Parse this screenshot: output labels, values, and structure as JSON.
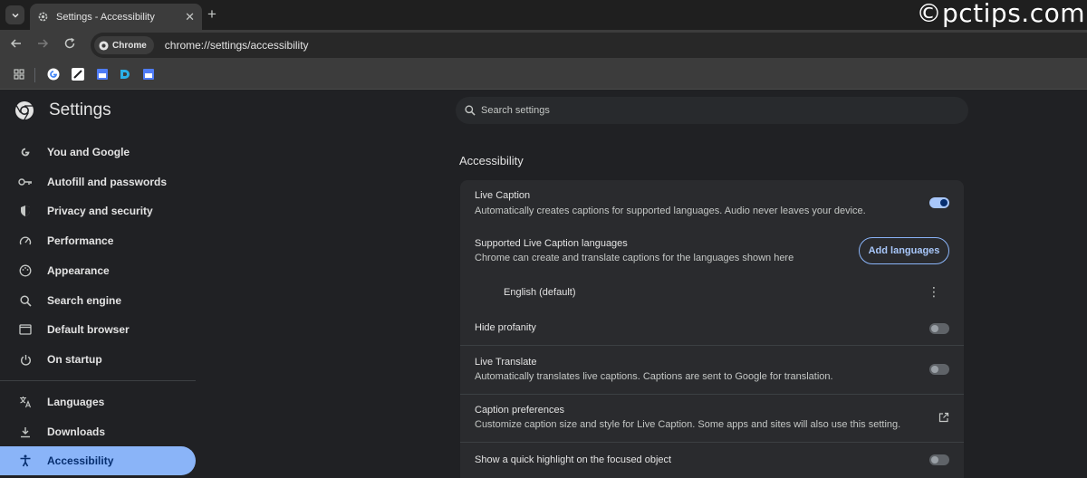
{
  "tab": {
    "title": "Settings - Accessibility",
    "close": "✕",
    "new_tab": "+"
  },
  "watermark": "©pctips.com",
  "omnibox": {
    "chip": "Chrome",
    "url": "chrome://settings/accessibility"
  },
  "sidebar": {
    "title": "Settings",
    "items": [
      {
        "label": "You and Google",
        "icon": "google-g-icon"
      },
      {
        "label": "Autofill and passwords",
        "icon": "key-icon"
      },
      {
        "label": "Privacy and security",
        "icon": "shield-icon"
      },
      {
        "label": "Performance",
        "icon": "speedometer-icon"
      },
      {
        "label": "Appearance",
        "icon": "palette-icon"
      },
      {
        "label": "Search engine",
        "icon": "search-icon"
      },
      {
        "label": "Default browser",
        "icon": "browser-icon"
      },
      {
        "label": "On startup",
        "icon": "power-icon"
      },
      {
        "label": "Languages",
        "icon": "translate-icon"
      },
      {
        "label": "Downloads",
        "icon": "download-icon"
      },
      {
        "label": "Accessibility",
        "icon": "accessibility-icon",
        "active": true
      }
    ]
  },
  "search": {
    "placeholder": "Search settings"
  },
  "main": {
    "section_title": "Accessibility",
    "live_caption": {
      "title": "Live Caption",
      "sub": "Automatically creates captions for supported languages. Audio never leaves your device.",
      "enabled": true
    },
    "supported_langs": {
      "title": "Supported Live Caption languages",
      "sub": "Chrome can create and translate captions for the languages shown here",
      "button": "Add languages"
    },
    "language_entry": "English (default)",
    "hide_profanity": {
      "title": "Hide profanity",
      "enabled": false
    },
    "live_translate": {
      "title": "Live Translate",
      "sub": "Automatically translates live captions. Captions are sent to Google for translation.",
      "enabled": false
    },
    "caption_prefs": {
      "title": "Caption preferences",
      "sub": "Customize caption size and style for Live Caption. Some apps and sites will also use this setting."
    },
    "quick_highlight": {
      "title": "Show a quick highlight on the focused object",
      "enabled": false
    }
  },
  "colors": {
    "accent": "#8ab4f8",
    "active_text": "#062e6f",
    "bg": "#202124",
    "card": "#2a2b2e"
  }
}
